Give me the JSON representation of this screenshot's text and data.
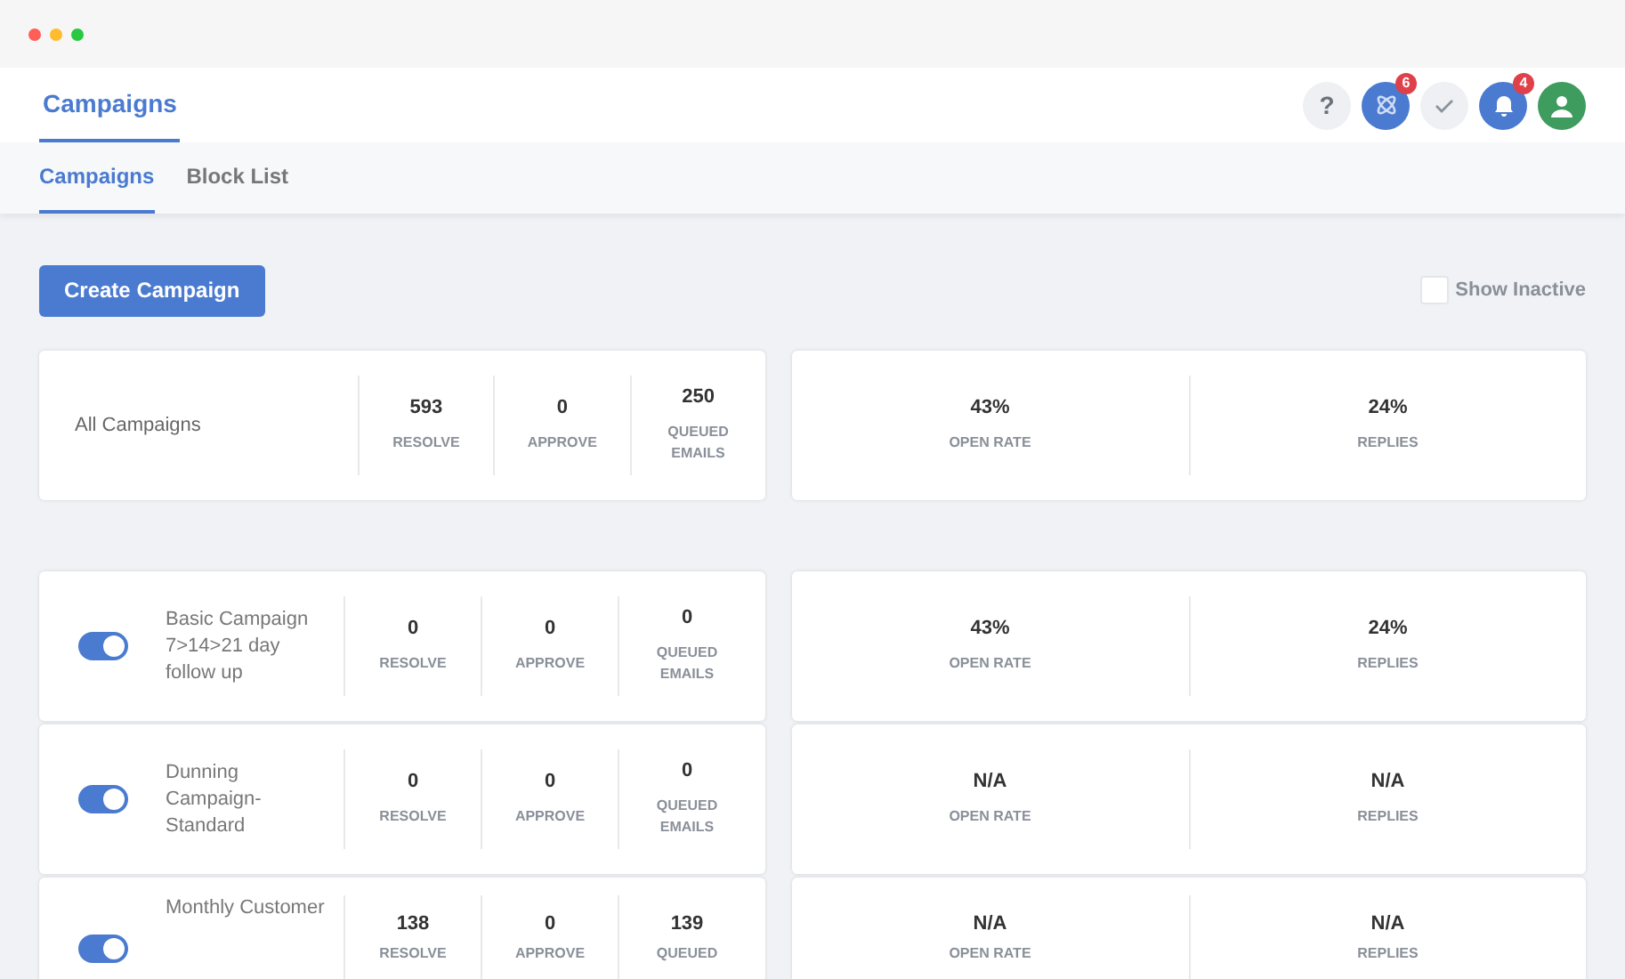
{
  "header": {
    "title": "Campaigns",
    "help": "?",
    "badges": [
      {
        "kind": "atom",
        "count": "6"
      },
      {
        "kind": "check"
      },
      {
        "kind": "bell",
        "count": "4"
      },
      {
        "kind": "user"
      }
    ]
  },
  "tabs": [
    {
      "label": "Campaigns",
      "selected": true
    },
    {
      "label": "Block List",
      "selected": false
    }
  ],
  "create_button": "Create Campaign",
  "show_inactive": {
    "label": "Show Inactive",
    "checked": false
  },
  "summary": {
    "name": "All Campaigns",
    "stats": [
      {
        "value": "593",
        "label": "RESOLVE"
      },
      {
        "value": "0",
        "label": "APPROVE"
      },
      {
        "value": "250",
        "label": "QUEUED EMAILS"
      }
    ],
    "rates": [
      {
        "value": "43%",
        "label": "OPEN RATE"
      },
      {
        "value": "24%",
        "label": "REPLIES"
      }
    ]
  },
  "campaigns": [
    {
      "name": "Basic Campaign 7>14>21 day follow up",
      "on": true,
      "stats": [
        {
          "value": "0",
          "label": "RESOLVE"
        },
        {
          "value": "0",
          "label": "APPROVE"
        },
        {
          "value": "0",
          "label": "QUEUED EMAILS"
        }
      ],
      "rates": [
        {
          "value": "43%",
          "label": "OPEN RATE"
        },
        {
          "value": "24%",
          "label": "REPLIES"
        }
      ]
    },
    {
      "name": "Dunning Campaign-Standard",
      "on": true,
      "stats": [
        {
          "value": "0",
          "label": "RESOLVE"
        },
        {
          "value": "0",
          "label": "APPROVE"
        },
        {
          "value": "0",
          "label": "QUEUED EMAILS"
        }
      ],
      "rates": [
        {
          "value": "N/A",
          "label": "OPEN RATE"
        },
        {
          "value": "N/A",
          "label": "REPLIES"
        }
      ]
    },
    {
      "name": "Monthly Customer",
      "on": true,
      "stats": [
        {
          "value": "138",
          "label": "RESOLVE"
        },
        {
          "value": "0",
          "label": "APPROVE"
        },
        {
          "value": "139",
          "label": "QUEUED"
        }
      ],
      "rates": [
        {
          "value": "N/A",
          "label": "OPEN RATE"
        },
        {
          "value": "N/A",
          "label": "REPLIES"
        }
      ]
    }
  ]
}
